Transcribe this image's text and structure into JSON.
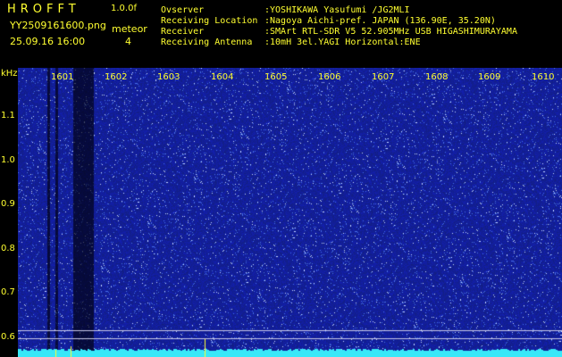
{
  "header": {
    "logo": "HROFFT",
    "version": "1.0.0f",
    "filename": "YY2509161600.png",
    "datetime": "25.09.16 16:00",
    "meteor_label": "meteor",
    "meteor_count": "4",
    "observer_label": "Ovserver",
    "observer_value": ":YOSHIKAWA Yasufumi /JG2MLI",
    "location_label": "Receiving Location",
    "location_value": ":Nagoya Aichi-pref. JAPAN (136.90E, 35.20N)",
    "receiver_label": "Receiver",
    "receiver_value": ":SMArt RTL-SDR V5 52.905MHz USB HIGASHIMURAYAMA",
    "antenna_label": "Receiving Antenna",
    "antenna_value": ":10mH 3el.YAGI Horizontal:ENE"
  },
  "axis": {
    "y_unit": "kHz",
    "y_ticks": [
      "1.1",
      "1.0",
      "0.9",
      "0.8",
      "0.7",
      "0.6"
    ],
    "x_ticks": [
      "1601",
      "1602",
      "1603",
      "1604",
      "1605",
      "1606",
      "1607",
      "1608",
      "1609",
      "1610"
    ]
  },
  "colors": {
    "text": "#ffff30",
    "background": "#000000",
    "spectrum_bg": "#1a2a9a",
    "trace": "#38e8f8"
  }
}
